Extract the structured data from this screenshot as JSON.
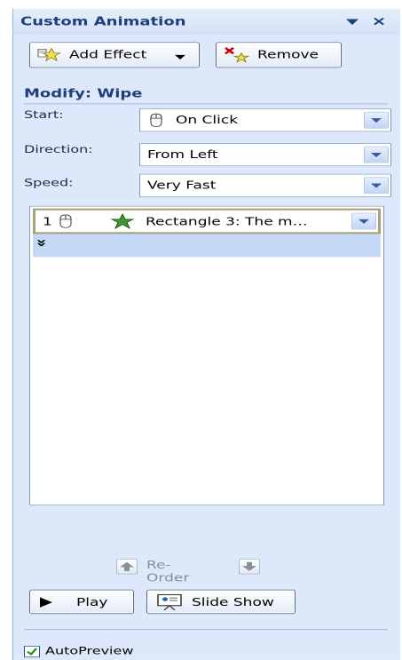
{
  "pane": {
    "title": "Custom Animation",
    "close_glyph": "×"
  },
  "toolbar": {
    "add_effect_label": "Add Effect",
    "remove_label": "Remove"
  },
  "modify": {
    "title": "Modify: Wipe",
    "start_label": "Start:",
    "start_value": "On Click",
    "direction_label": "Direction:",
    "direction_value": "From Left",
    "speed_label": "Speed:",
    "speed_value": "Very Fast"
  },
  "animation_list": {
    "items": [
      {
        "index": "1",
        "name": "Rectangle 3: The m…"
      }
    ],
    "expand_glyph": "»"
  },
  "reorder": {
    "label": "Re-Order"
  },
  "playback": {
    "play_label": "Play",
    "slideshow_label": "Slide Show"
  },
  "autopreview": {
    "label": "AutoPreview",
    "checked": true
  },
  "colors": {
    "pane_bg": "#dde9fa",
    "accent_text": "#1f3f7a",
    "selected_row": "#c4d9f5",
    "checkbox_check": "#1f8a1f"
  }
}
